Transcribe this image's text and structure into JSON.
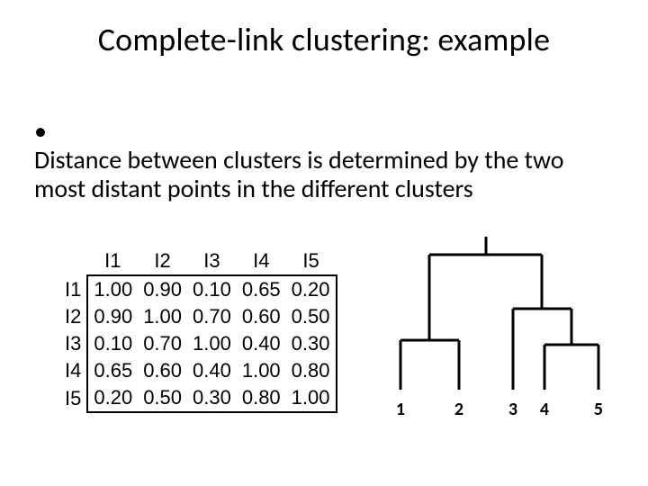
{
  "title": "Complete-link clustering: example",
  "bullet": "Distance between clusters is determined by the two most distant points in the different clusters",
  "matrix": {
    "headers": [
      "I1",
      "I2",
      "I3",
      "I4",
      "I5"
    ],
    "rows": [
      {
        "label": "I1",
        "cells": [
          "1.00",
          "0.90",
          "0.10",
          "0.65",
          "0.20"
        ]
      },
      {
        "label": "I2",
        "cells": [
          "0.90",
          "1.00",
          "0.70",
          "0.60",
          "0.50"
        ]
      },
      {
        "label": "I3",
        "cells": [
          "0.10",
          "0.70",
          "1.00",
          "0.40",
          "0.30"
        ]
      },
      {
        "label": "I4",
        "cells": [
          "0.65",
          "0.60",
          "0.40",
          "1.00",
          "0.80"
        ]
      },
      {
        "label": "I5",
        "cells": [
          "0.20",
          "0.50",
          "0.30",
          "0.80",
          "1.00"
        ]
      }
    ]
  },
  "dendrogram": {
    "leaves": [
      "1",
      "2",
      "3",
      "4",
      "5"
    ]
  },
  "chart_data": {
    "type": "table",
    "title": "Similarity matrix",
    "categories": [
      "I1",
      "I2",
      "I3",
      "I4",
      "I5"
    ],
    "series": [
      {
        "name": "I1",
        "values": [
          1.0,
          0.9,
          0.1,
          0.65,
          0.2
        ]
      },
      {
        "name": "I2",
        "values": [
          0.9,
          1.0,
          0.7,
          0.6,
          0.5
        ]
      },
      {
        "name": "I3",
        "values": [
          0.1,
          0.7,
          1.0,
          0.4,
          0.3
        ]
      },
      {
        "name": "I4",
        "values": [
          0.65,
          0.6,
          0.4,
          1.0,
          0.8
        ]
      },
      {
        "name": "I5",
        "values": [
          0.2,
          0.5,
          0.3,
          0.8,
          1.0
        ]
      }
    ]
  }
}
